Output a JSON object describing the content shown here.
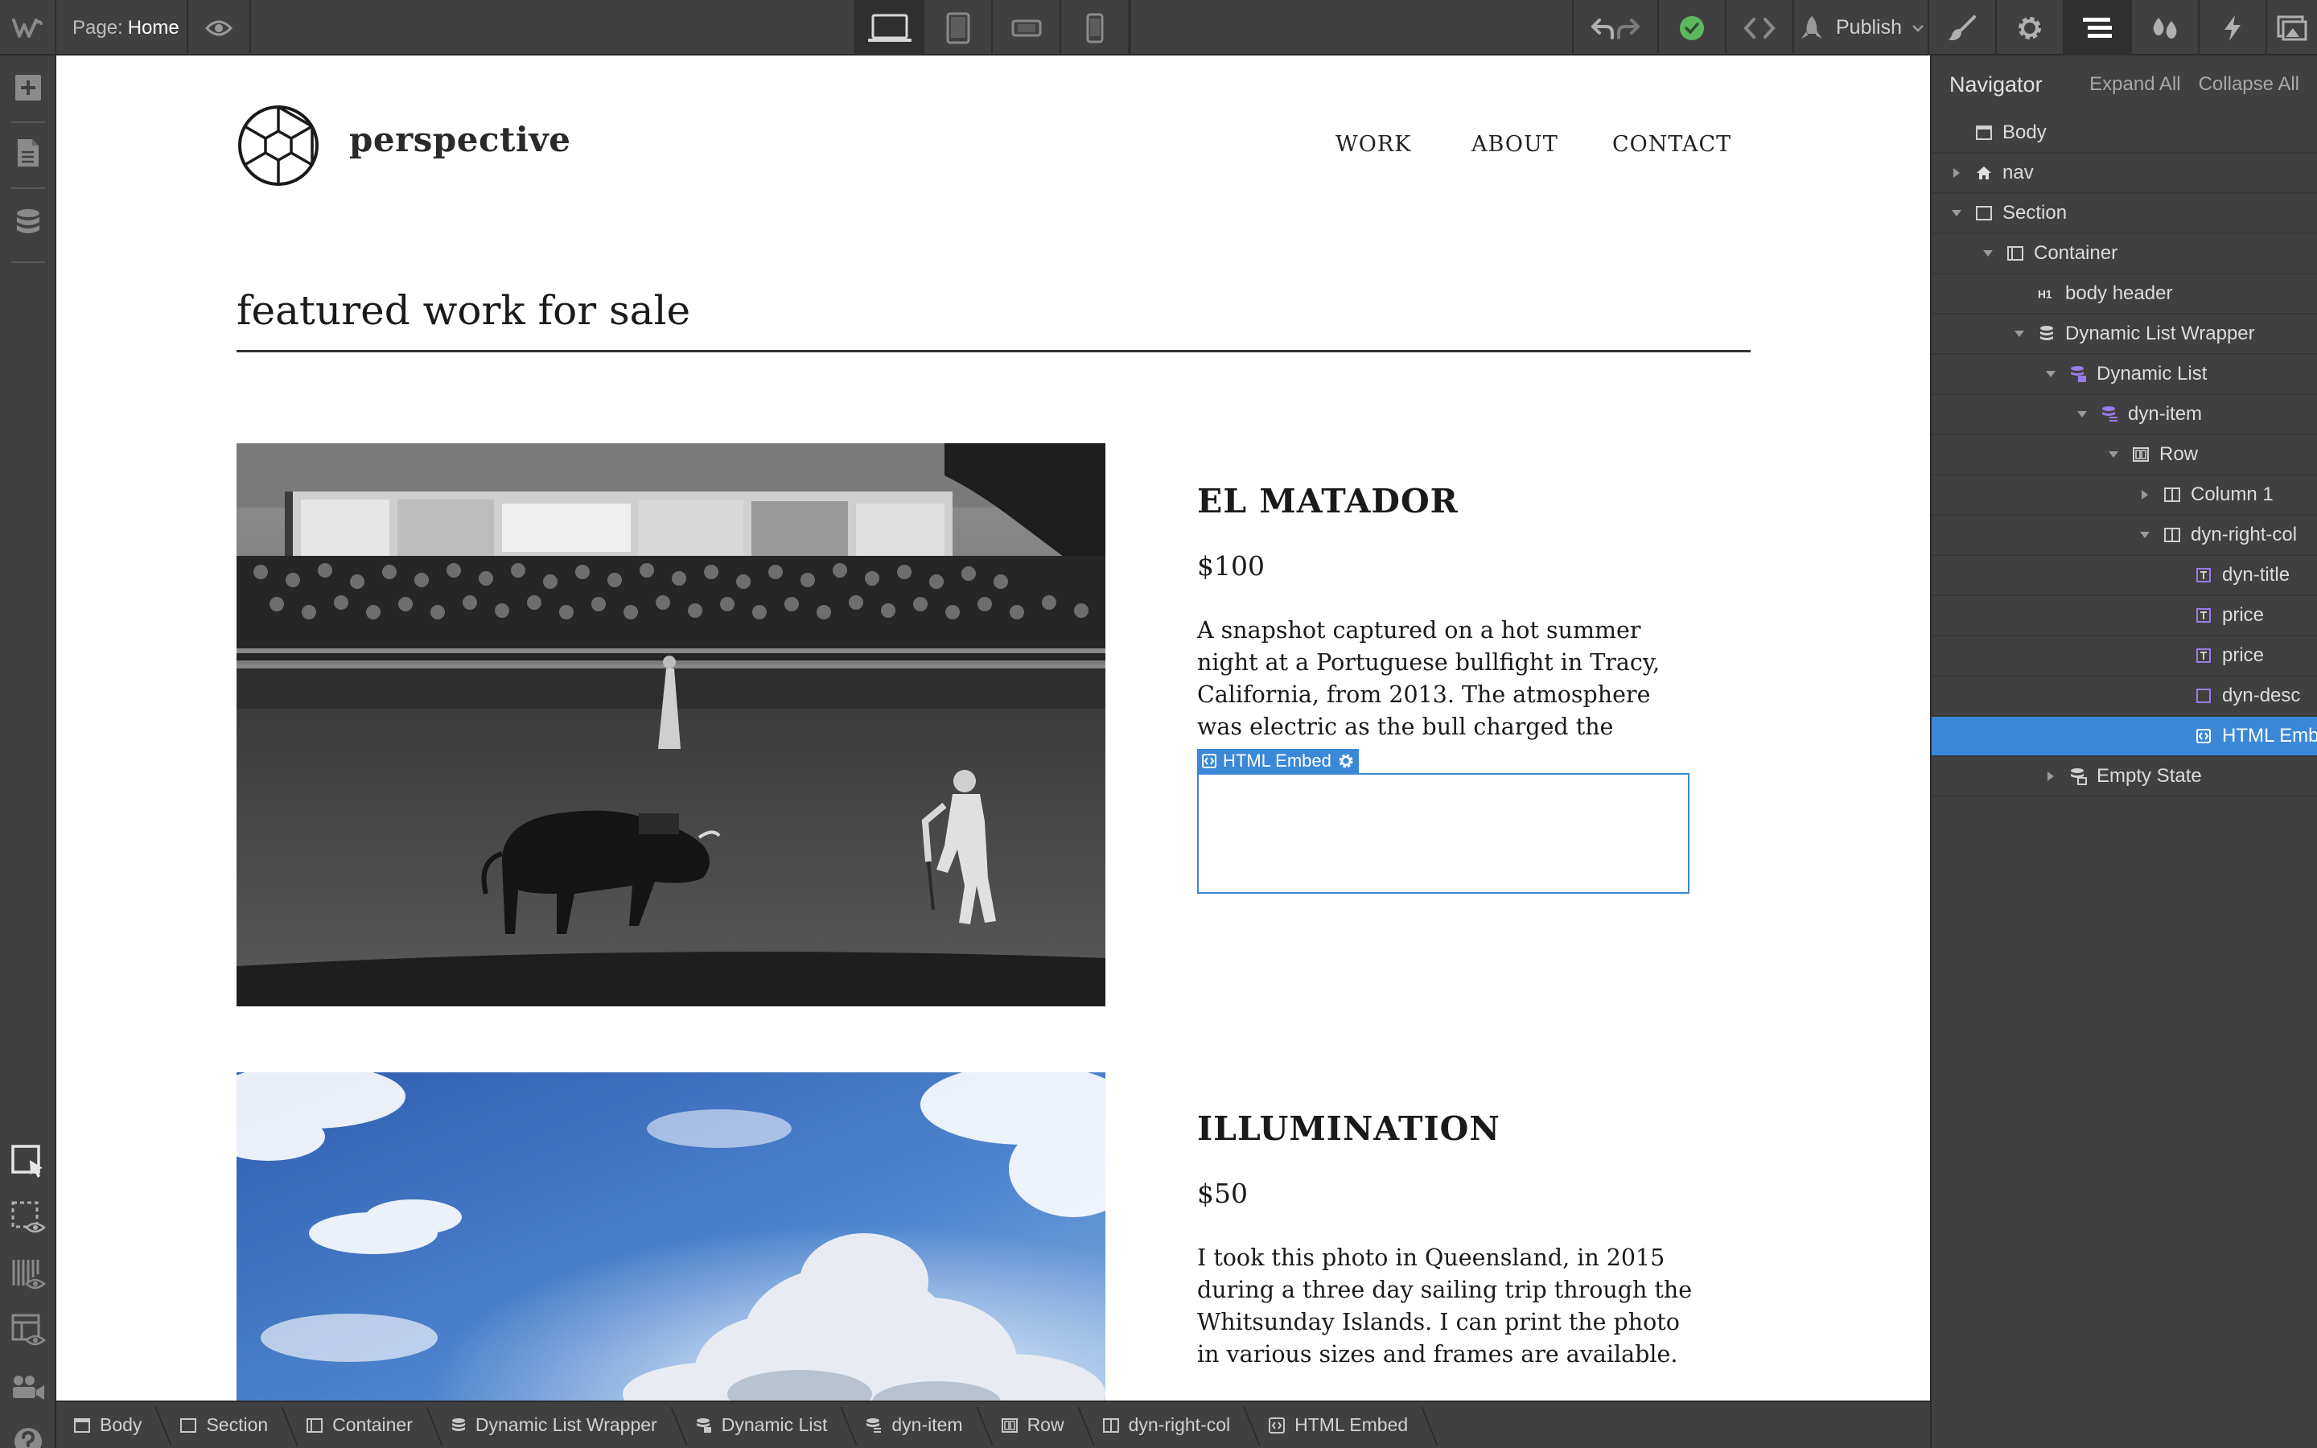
{
  "topbar": {
    "page_prefix": "Page:",
    "page_name": "Home",
    "publish_label": "Publish"
  },
  "site": {
    "brand": "perspective",
    "nav": [
      "WORK",
      "ABOUT",
      "CONTACT"
    ],
    "section_title": "featured work for sale",
    "items": [
      {
        "title": "EL MATADOR",
        "price": "$100",
        "desc": "A snapshot captured on a hot summer night at a Portuguese bullfight in Tracy, California, from 2013. The atmosphere was electric as the bull charged the matador."
      },
      {
        "title": "ILLUMINATION",
        "price": "$50",
        "desc": "I took this photo in Queensland, in 2015 during a three day sailing trip through the Whitsunday Islands. I can print the photo in various sizes and frames are available."
      }
    ],
    "embed_label": "HTML Embed"
  },
  "navigator": {
    "title": "Navigator",
    "expand_all": "Expand All",
    "collapse_all": "Collapse All",
    "tree": [
      {
        "label": "Body",
        "icon": "body-icon"
      },
      {
        "label": "nav",
        "icon": "home-icon"
      },
      {
        "label": "Section",
        "icon": "section-icon"
      },
      {
        "label": "Container",
        "icon": "container-icon"
      },
      {
        "label": "body header",
        "icon": "heading-icon"
      },
      {
        "label": "Dynamic List Wrapper",
        "icon": "database-icon"
      },
      {
        "label": "Dynamic List",
        "icon": "dynamic-list-icon"
      },
      {
        "label": "dyn-item",
        "icon": "dynamic-item-icon"
      },
      {
        "label": "Row",
        "icon": "row-icon"
      },
      {
        "label": "Column 1",
        "icon": "column-icon"
      },
      {
        "label": "dyn-right-col",
        "icon": "column-icon"
      },
      {
        "label": "dyn-title",
        "icon": "text-icon"
      },
      {
        "label": "price",
        "icon": "text-icon"
      },
      {
        "label": "price",
        "icon": "text-icon"
      },
      {
        "label": "dyn-desc",
        "icon": "div-icon"
      },
      {
        "label": "HTML Embed",
        "icon": "embed-icon"
      },
      {
        "label": "Empty State",
        "icon": "empty-state-icon"
      }
    ]
  },
  "breadcrumbs": [
    "Body",
    "Section",
    "Container",
    "Dynamic List Wrapper",
    "Dynamic List",
    "dyn-item",
    "Row",
    "dyn-right-col",
    "HTML Embed"
  ],
  "colors": {
    "accent": "#3b88d8",
    "chrome": "#404040",
    "dynamic_purple": "#9b7be8",
    "ok_green": "#5cb85c"
  }
}
